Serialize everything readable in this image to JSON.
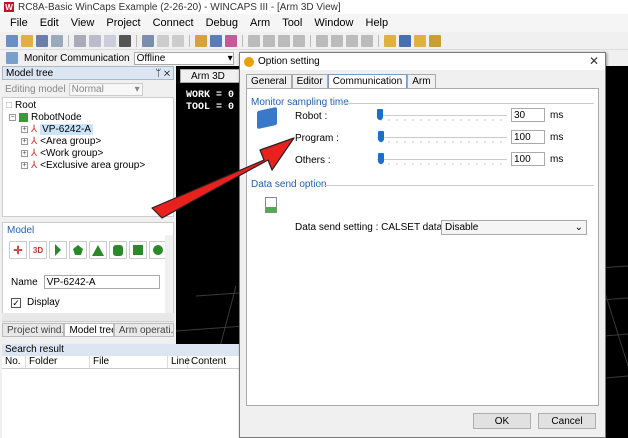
{
  "window": {
    "title": "RC8A-Basic WinCaps Example (2-26-20) - WINCAPS III - [Arm 3D View]"
  },
  "menu": [
    "File",
    "Edit",
    "View",
    "Project",
    "Connect",
    "Debug",
    "Arm",
    "Tool",
    "Window",
    "Help"
  ],
  "toolbar2": {
    "label": "Monitor Communication",
    "status": "Offline"
  },
  "model_tree": {
    "header": "Model tree",
    "pin": "ᛘ ✕",
    "editing_label": "Editing model",
    "editing_value": "Normal",
    "root": "Root",
    "robot_node": "RobotNode",
    "items": [
      "VP-6242-A",
      "<Area group>",
      "<Work group>",
      "<Exclusive area group>"
    ]
  },
  "model_panel": {
    "title": "Model",
    "name_label": "Name",
    "name_value": "VP-6242-A",
    "display_label": "Display",
    "display_checked": "✓"
  },
  "left_tabs": [
    "Project wind...",
    "Model tree",
    "Arm operati..."
  ],
  "search": {
    "title": "Search result",
    "columns": [
      "No.",
      "Folder",
      "File",
      "Line",
      "Content"
    ]
  },
  "view": {
    "tab": "Arm 3D",
    "work": "WORK = 0",
    "tool": "TOOL = 0"
  },
  "dialog": {
    "title": "Option setting",
    "close": "✕",
    "tabs": [
      "General",
      "Editor",
      "Communication",
      "Arm"
    ],
    "monitor_group": "Monitor sampling time",
    "rows": [
      {
        "label": "Robot :",
        "value": "30",
        "unit": "ms"
      },
      {
        "label": "Program :",
        "value": "100",
        "unit": "ms"
      },
      {
        "label": "Others :",
        "value": "100",
        "unit": "ms"
      }
    ],
    "data_send_group": "Data send option",
    "data_send_label": "Data send setting : CALSET data",
    "data_send_value": "Disable",
    "ok": "OK",
    "cancel": "Cancel"
  },
  "colors": {
    "accent": "#1a6fc9",
    "arrow": "#e8201e",
    "group_title": "#2060b0"
  }
}
